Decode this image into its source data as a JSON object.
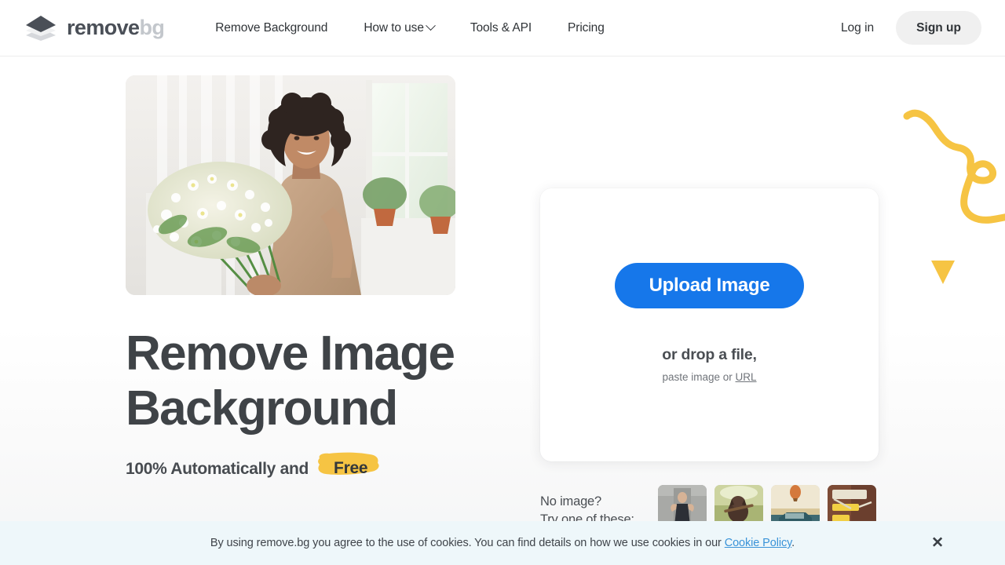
{
  "brand": {
    "name_primary": "remove",
    "name_secondary": "bg",
    "logo_icon": "layers-diamond-icon",
    "accent_blue": "#1677ea",
    "accent_yellow": "#f6c443",
    "text_dark": "#3f4347"
  },
  "header": {
    "nav": [
      {
        "label": "Remove Background",
        "icon": null
      },
      {
        "label": "How to use",
        "icon": "chevron-down-icon"
      },
      {
        "label": "Tools & API",
        "icon": null
      },
      {
        "label": "Pricing",
        "icon": null
      }
    ],
    "login_label": "Log in",
    "signup_label": "Sign up"
  },
  "hero": {
    "photo_alt": "woman-holding-flowers-photo",
    "title_line1": "Remove Image",
    "title_line2": "Background",
    "subtitle_prefix": "100% Automatically and",
    "subtitle_highlight": "Free"
  },
  "upload": {
    "button_label": "Upload Image",
    "drop_text": "or drop a file,",
    "paste_prefix": "paste image or ",
    "paste_link": "URL"
  },
  "samples": {
    "label_line1": "No image?",
    "label_line2": "Try one of these:",
    "thumbs": [
      {
        "name": "sample-woman-flexing"
      },
      {
        "name": "sample-dog-with-stick"
      },
      {
        "name": "sample-balloon-over-car"
      },
      {
        "name": "sample-paint-rollers"
      }
    ]
  },
  "cookie": {
    "text_before": "By using remove.bg you agree to the use of cookies. You can find details on how we use cookies in our ",
    "link_label": "Cookie Policy",
    "text_after": ".",
    "close_icon": "close-icon",
    "close_glyph": "✕"
  }
}
